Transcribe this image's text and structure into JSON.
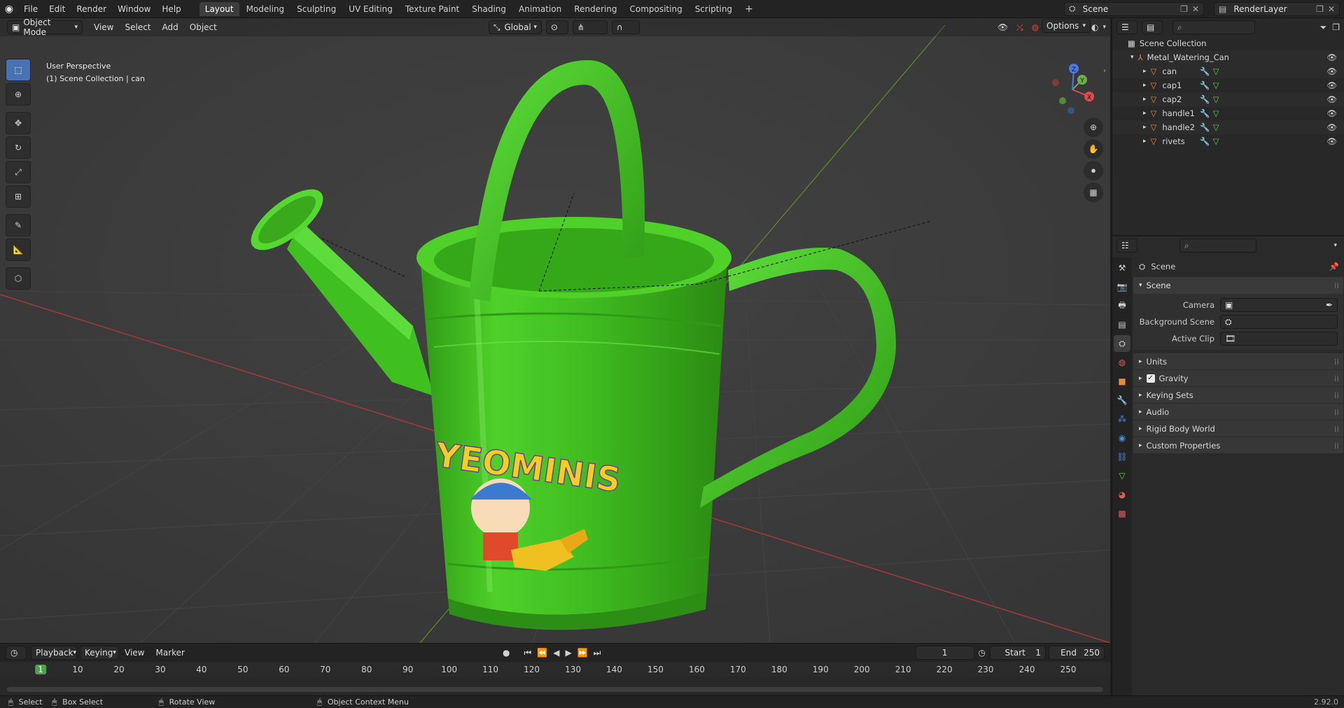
{
  "topbar": {
    "menus": [
      "File",
      "Edit",
      "Render",
      "Window",
      "Help"
    ],
    "workspace_tabs": [
      "Layout",
      "Modeling",
      "Sculpting",
      "UV Editing",
      "Texture Paint",
      "Shading",
      "Animation",
      "Rendering",
      "Compositing",
      "Scripting"
    ],
    "active_tab": "Layout",
    "add_tab": "+",
    "scene_name": "Scene",
    "view_layer": "RenderLayer"
  },
  "viewport": {
    "mode": "Object Mode",
    "menus": [
      "View",
      "Select",
      "Add",
      "Object"
    ],
    "transform_orientation": "Global",
    "options_label": "Options",
    "overlay_title": "User Perspective",
    "overlay_subtitle": "(1) Scene Collection | can",
    "gizmo_axes": {
      "x": "X",
      "y": "Y",
      "z": "Z"
    },
    "logo_text": "YEOMINIS",
    "colors": {
      "can_green": "#4fd12a",
      "background": "#3a3a3a",
      "x_axis": "#a33a3a",
      "y_axis": "#5a8a2a",
      "active_tool": "#4772b3"
    }
  },
  "timeline": {
    "menus": [
      "Playback",
      "Keying",
      "View",
      "Marker"
    ],
    "current_frame": "1",
    "start_label": "Start",
    "start_value": "1",
    "end_label": "End",
    "end_value": "250",
    "ruler": [
      "1",
      "10",
      "20",
      "30",
      "40",
      "50",
      "60",
      "70",
      "80",
      "90",
      "100",
      "110",
      "120",
      "130",
      "140",
      "150",
      "160",
      "170",
      "180",
      "190",
      "200",
      "210",
      "220",
      "230",
      "240",
      "250"
    ]
  },
  "status": {
    "select": "Select",
    "box_select": "Box Select",
    "rotate_view": "Rotate View",
    "context_menu": "Object Context Menu",
    "version": "2.92.0"
  },
  "outliner": {
    "root": "Scene Collection",
    "collection": "Metal_Watering_Can",
    "objects": [
      "can",
      "cap1",
      "cap2",
      "handle1",
      "handle2",
      "rivets"
    ]
  },
  "properties": {
    "context_title": "Scene",
    "panel_title": "Scene",
    "camera_label": "Camera",
    "background_label": "Background Scene",
    "clip_label": "Active Clip",
    "subpanels": [
      "Units",
      "Gravity",
      "Keying Sets",
      "Audio",
      "Rigid Body World",
      "Custom Properties"
    ],
    "gravity_checked": true
  }
}
